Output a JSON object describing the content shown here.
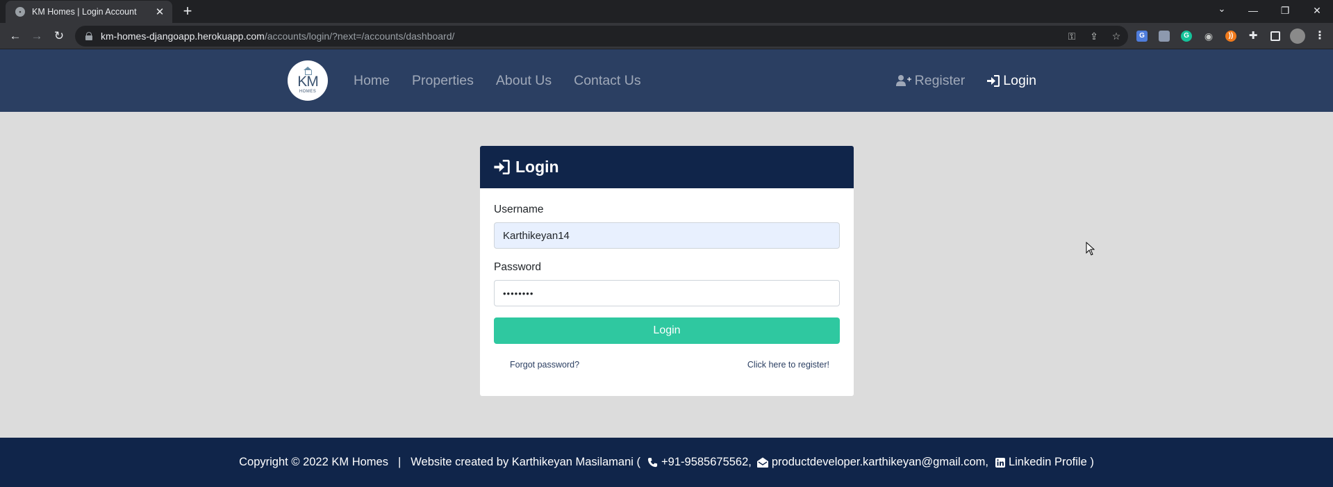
{
  "browser": {
    "tab_title": "KM Homes | Login Account",
    "url_host": "km-homes-djangoapp.herokuapp.com",
    "url_path": "/accounts/login/?next=/accounts/dashboard/"
  },
  "navbar": {
    "brand_km": "KM",
    "brand_homes": "HOMES",
    "links": [
      "Home",
      "Properties",
      "About Us",
      "Contact Us"
    ],
    "register_label": "Register",
    "login_label": "Login"
  },
  "login_card": {
    "title": "Login",
    "username_label": "Username",
    "username_value": "Karthikeyan14",
    "password_label": "Password",
    "password_value": "••••••••",
    "submit_label": "Login",
    "forgot_link": "Forgot password?",
    "register_link": "Click here to register!"
  },
  "footer": {
    "copyright": "Copyright © 2022 KM Homes",
    "separator": "|",
    "created_by": "Website created by Karthikeyan Masilamani (",
    "phone": "+91-9585675562,",
    "email": "productdeveloper.karthikeyan@gmail.com,",
    "linkedin": "Linkedin Profile )"
  },
  "colors": {
    "navbar_bg": "#2b3f62",
    "card_header_bg": "#10254a",
    "footer_bg": "#10254a",
    "button_accent": "#2fc8a0",
    "page_bg": "#dcdcdc"
  }
}
